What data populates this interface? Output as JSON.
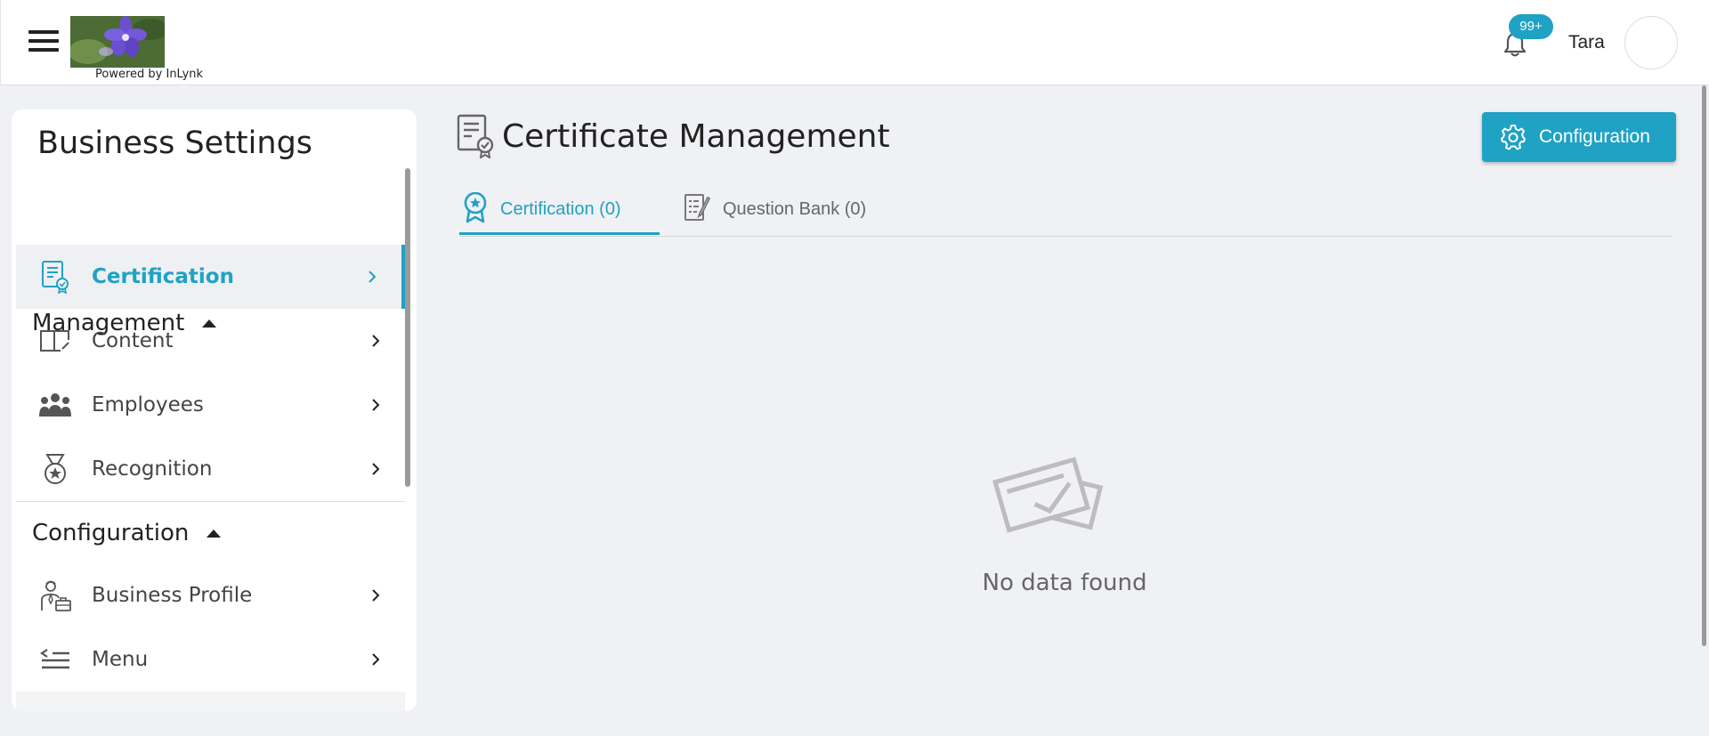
{
  "header": {
    "logo_caption": "Powered by InLynk",
    "notification_badge": "99+",
    "user_name": "Tara"
  },
  "sidebar": {
    "title": "Business Settings",
    "sections": [
      {
        "label": "Management",
        "items": [
          {
            "label": "Certification",
            "icon": "certificate-icon",
            "active": true
          },
          {
            "label": "Content",
            "icon": "book-icon"
          },
          {
            "label": "Employees",
            "icon": "people-icon"
          },
          {
            "label": "Recognition",
            "icon": "medal-icon"
          }
        ]
      },
      {
        "label": "Configuration",
        "items": [
          {
            "label": "Business Profile",
            "icon": "business-profile-icon"
          },
          {
            "label": "Menu",
            "icon": "menu-list-icon"
          }
        ]
      }
    ]
  },
  "main": {
    "title": "Certificate Management",
    "config_button": "Configuration",
    "tabs": [
      {
        "label": "Certification (0)",
        "icon": "award-ribbon-icon",
        "active": true
      },
      {
        "label": "Question Bank (0)",
        "icon": "question-doc-icon",
        "active": false
      }
    ],
    "empty_text": "No data found"
  },
  "colors": {
    "accent": "#1fa2c4",
    "page_bg": "#f0f1f4",
    "active_row_bg": "#eef0f4"
  }
}
